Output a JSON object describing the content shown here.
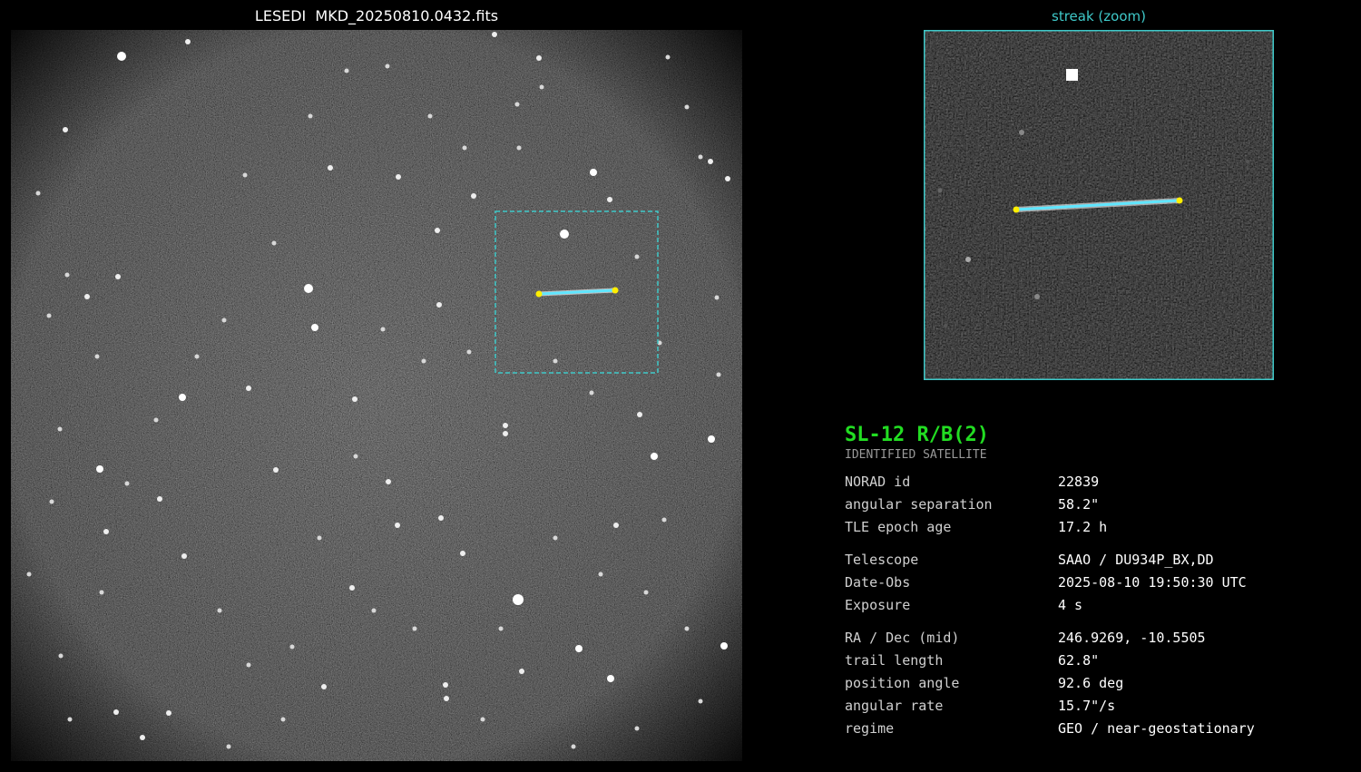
{
  "field": {
    "title": "LESEDI  MKD_20250810.0432.fits",
    "crop_box_color": "#3fc9c9",
    "streak_color": "#5fe6ff",
    "endpoint_color": "#ffee00"
  },
  "zoom": {
    "title": "streak (zoom)",
    "border_color": "#3fc9c9"
  },
  "info": {
    "name": "SL-12 R/B(2)",
    "subtitle": "IDENTIFIED SATELLITE",
    "groups": [
      [
        {
          "label": "NORAD id",
          "value": "22839"
        },
        {
          "label": "angular separation",
          "value": "58.2\""
        },
        {
          "label": "TLE epoch age",
          "value": "17.2 h"
        }
      ],
      [
        {
          "label": "Telescope",
          "value": "SAAO / DU934P_BX,DD"
        },
        {
          "label": "Date-Obs",
          "value": "2025-08-10 19:50:30 UTC"
        },
        {
          "label": "Exposure",
          "value": "4 s"
        }
      ],
      [
        {
          "label": "RA / Dec (mid)",
          "value": "246.9269, -10.5505"
        },
        {
          "label": "trail length",
          "value": "62.8\""
        },
        {
          "label": "position angle",
          "value": "92.6 deg"
        },
        {
          "label": "angular rate",
          "value": "15.7\"/s"
        },
        {
          "label": "regime",
          "value": "GEO / near-geostationary"
        }
      ]
    ]
  }
}
